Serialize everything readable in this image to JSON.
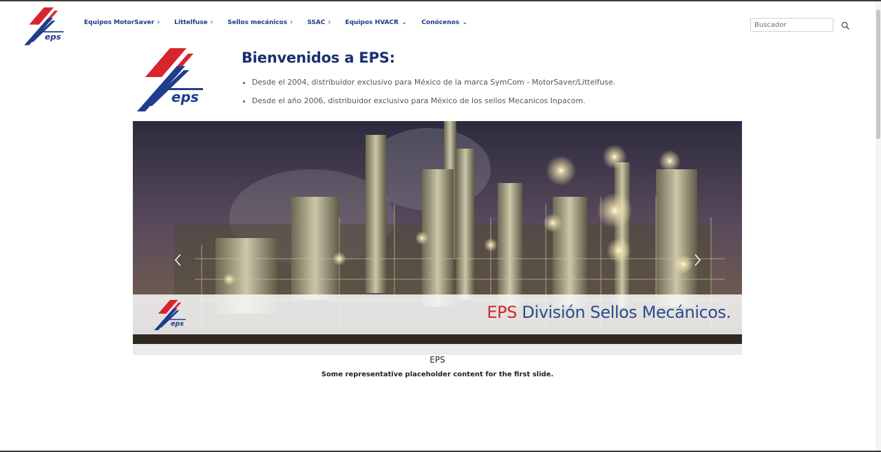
{
  "nav": {
    "items": [
      {
        "label": "Equipos MotorSaver",
        "caret": "›"
      },
      {
        "label": "Littelfuse",
        "caret": "›"
      },
      {
        "label": "Sellos mecánicos",
        "caret": "›"
      },
      {
        "label": "SSAC",
        "caret": "›"
      },
      {
        "label": "Equipos HVACR",
        "caret": "⌄"
      },
      {
        "label": "Conócenos",
        "caret": "⌄"
      }
    ],
    "search_placeholder": "Buscador",
    "search_value": ""
  },
  "welcome": {
    "title": "Bienvenidos a EPS:",
    "bullets": [
      "Desde el 2004, distribuidor exclusivo para México de la marca SymCom - MotorSaver/Littelfuse.",
      "Desde el año 2006, distribuidor exclusivo para México de los sellos Mecanicos Inpacom."
    ]
  },
  "carousel": {
    "banner_accent": "EPS",
    "banner_text": " División Sellos Mecánicos.",
    "caption_title": "EPS",
    "caption_text": "Some representative placeholder content for the first slide."
  },
  "logo_text": "eps",
  "colors": {
    "brand_blue": "#1b3c8a",
    "brand_red": "#d7252e",
    "title_navy": "#1b2f6e"
  },
  "icons": {
    "search": "search-icon",
    "prev": "chevron-left-icon",
    "next": "chevron-right-icon"
  }
}
